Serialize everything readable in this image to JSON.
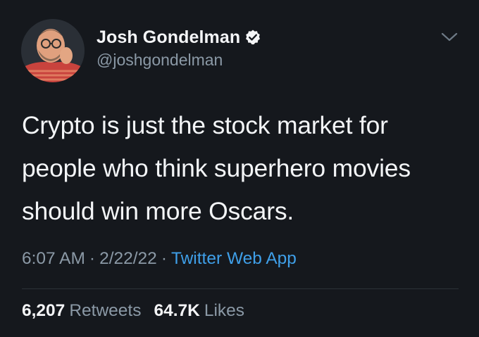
{
  "author": {
    "display_name": "Josh Gondelman",
    "handle": "@joshgondelman",
    "verified": true
  },
  "tweet": {
    "lines": [
      "Crypto is just the stock market for",
      "people who think superhero movies",
      "should win more Oscars."
    ],
    "time": "6:07 AM",
    "date": "2/22/22",
    "source": "Twitter Web App",
    "separator": "·"
  },
  "stats": {
    "retweets_count": "6,207",
    "retweets_label": "Retweets",
    "likes_count": "64.7K",
    "likes_label": "Likes"
  },
  "colors": {
    "background": "#15181d",
    "text": "#f3f5f7",
    "secondary_text": "#8b99a6",
    "link": "#3f9fe8",
    "divider": "#2c3238"
  },
  "icons": {
    "verified": "verified-badge-icon",
    "more": "chevron-down-icon"
  }
}
